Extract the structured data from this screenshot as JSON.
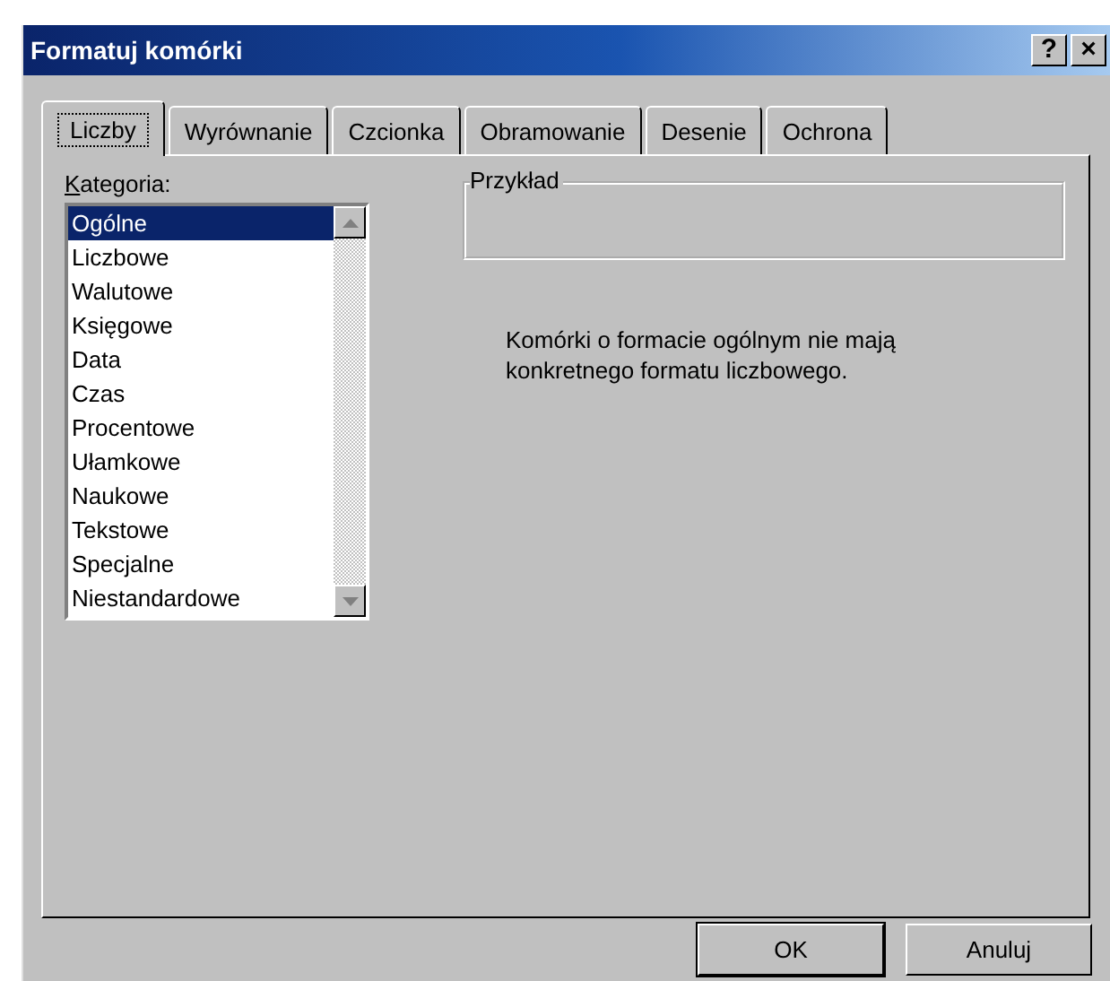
{
  "window": {
    "title": "Formatuj komórki",
    "help_button": "?",
    "close_button": "×"
  },
  "tabs": [
    {
      "label": "Liczby",
      "selected": true
    },
    {
      "label": "Wyrównanie",
      "selected": false
    },
    {
      "label": "Czcionka",
      "selected": false
    },
    {
      "label": "Obramowanie",
      "selected": false
    },
    {
      "label": "Desenie",
      "selected": false
    },
    {
      "label": "Ochrona",
      "selected": false
    }
  ],
  "category": {
    "label": "Kategoria:",
    "items": [
      {
        "label": "Ogólne",
        "selected": true
      },
      {
        "label": "Liczbowe",
        "selected": false
      },
      {
        "label": "Walutowe",
        "selected": false
      },
      {
        "label": "Księgowe",
        "selected": false
      },
      {
        "label": "Data",
        "selected": false
      },
      {
        "label": "Czas",
        "selected": false
      },
      {
        "label": "Procentowe",
        "selected": false
      },
      {
        "label": "Ułamkowe",
        "selected": false
      },
      {
        "label": "Naukowe",
        "selected": false
      },
      {
        "label": "Tekstowe",
        "selected": false
      },
      {
        "label": "Specjalne",
        "selected": false
      },
      {
        "label": "Niestandardowe",
        "selected": false
      }
    ]
  },
  "sample": {
    "label": "Przykład"
  },
  "description": "Komórki o formacie ogólnym nie mają konkretnego formatu liczbowego.",
  "buttons": [
    {
      "label": "OK",
      "default": true
    },
    {
      "label": "Anuluj",
      "default": false
    }
  ]
}
